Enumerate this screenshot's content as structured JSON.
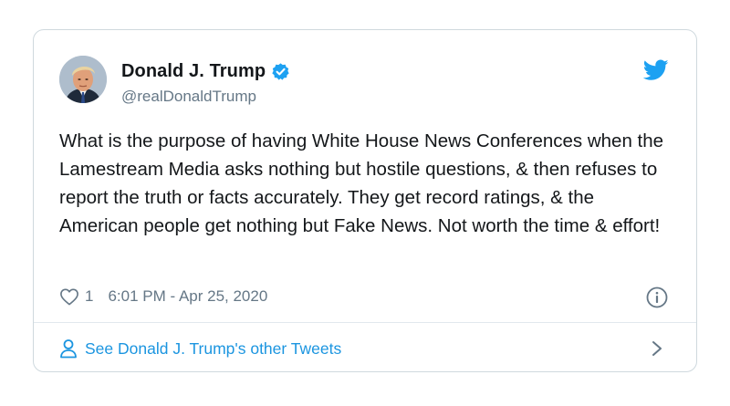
{
  "author": {
    "display_name": "Donald J. Trump",
    "handle": "@realDonaldTrump",
    "verified": true
  },
  "tweet": {
    "text": "What is the purpose of having White House News Conferences when the Lamestream Media asks nothing but hostile questions, & then refuses to report the truth or facts accurately. They get record ratings, & the American people get nothing but Fake News. Not worth the time & effort!",
    "like_count": "1",
    "timestamp": "6:01 PM - Apr 25, 2020"
  },
  "footer": {
    "see_more_label": "See Donald J. Trump's other Tweets"
  },
  "colors": {
    "accent": "#1da1f2",
    "link": "#1b95e0",
    "muted": "#657786",
    "border": "#cfd9de"
  },
  "icons": [
    "verified-badge-icon",
    "twitter-bird-icon",
    "heart-icon",
    "info-icon",
    "person-icon",
    "chevron-right-icon"
  ]
}
